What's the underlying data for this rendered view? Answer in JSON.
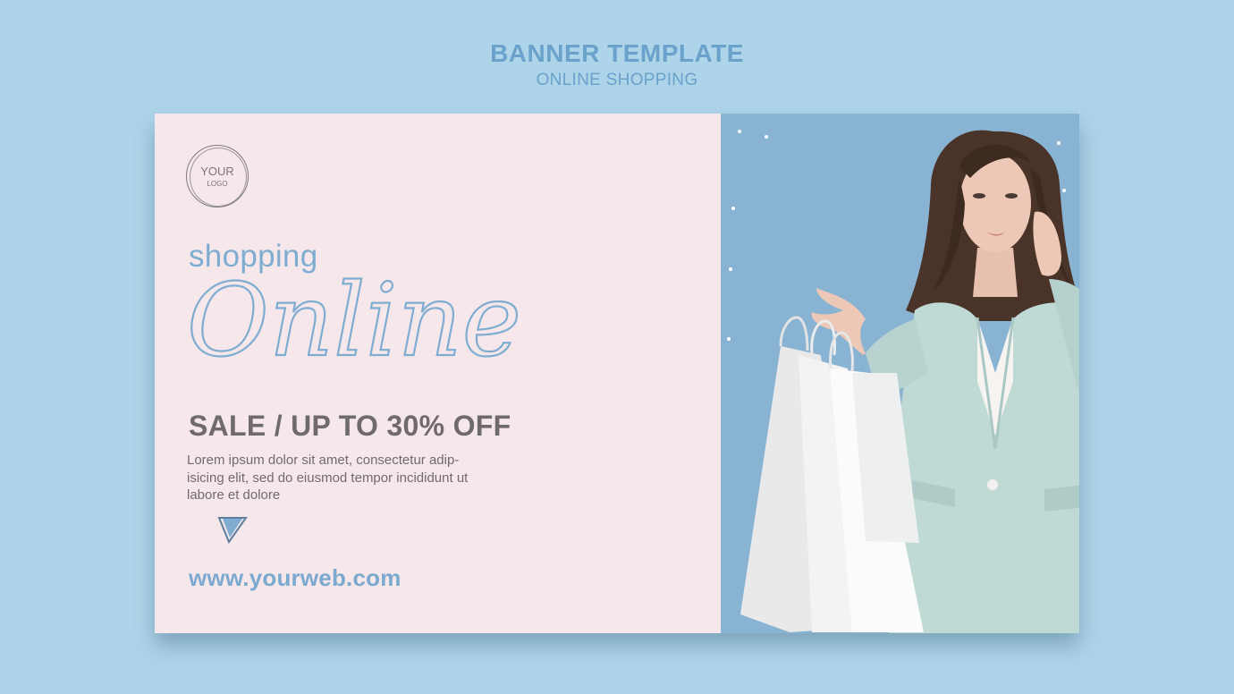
{
  "header": {
    "title": "BANNER TEMPLATE",
    "subtitle": "ONLINE SHOPPING"
  },
  "banner": {
    "logo": {
      "line1": "YOUR",
      "line2": "LOGO"
    },
    "script_small": "shopping",
    "script_large": "Online",
    "sale": "SALE / UP TO 30% OFF",
    "description": "Lorem ipsum dolor sit amet, consectetur adip- isicing elit, sed do eiusmod tempor incididunt ut labore et dolore",
    "website": "www.yourweb.com"
  },
  "icons": {
    "logo_badge": "circle-logo-icon",
    "pointer": "triangle-down-icon"
  },
  "colors": {
    "background": "#aed4e9",
    "banner_left": "#f6e8ea",
    "banner_right": "#88b3d3",
    "accent_blue": "#7fadd2",
    "text_gray": "#6f6b6d",
    "header_blue": "#6aa2cb"
  }
}
